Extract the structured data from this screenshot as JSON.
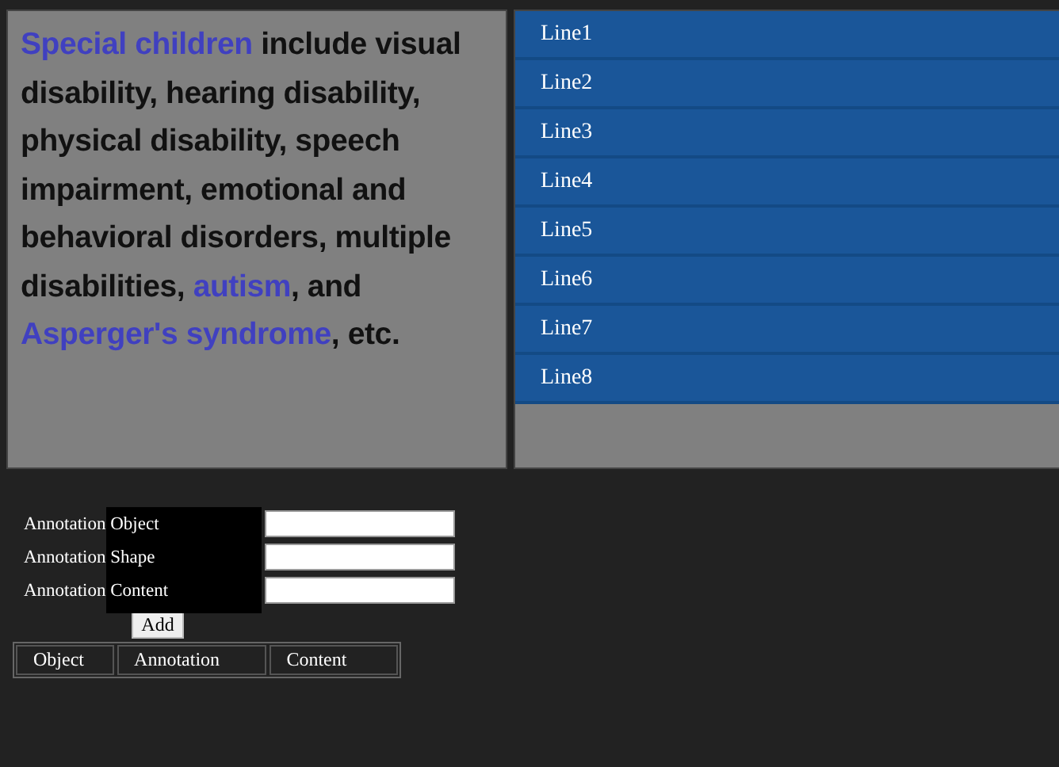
{
  "text_panel": {
    "paragraph": [
      {
        "text": "Special children",
        "highlighted": true
      },
      {
        "text": " include visual disability, hearing disability, physical disability, speech impairment, emotional and behavioral disorders, multiple disabilities, ",
        "highlighted": false
      },
      {
        "text": "autism",
        "highlighted": true
      },
      {
        "text": ", and ",
        "highlighted": false
      },
      {
        "text": "Asperger's syndrome",
        "highlighted": true
      },
      {
        "text": ", etc.",
        "highlighted": false
      }
    ]
  },
  "lines": [
    "Line1",
    "Line2",
    "Line3",
    "Line4",
    "Line5",
    "Line6",
    "Line7",
    "Line8"
  ],
  "form": {
    "fields": [
      {
        "label": "Annotation Object"
      },
      {
        "label": "Annotation Shape"
      },
      {
        "label": "Annotation Content"
      }
    ],
    "button": "Add"
  },
  "table": {
    "columns": [
      "Object",
      "Annotation",
      "Content"
    ]
  }
}
